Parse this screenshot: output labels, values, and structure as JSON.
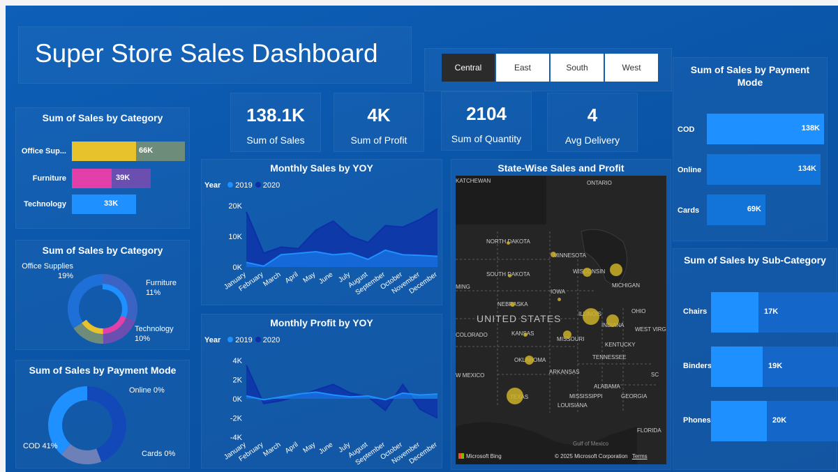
{
  "title": "Super Store Sales Dashboard",
  "region_slicer": {
    "options": [
      "Central",
      "East",
      "South",
      "West"
    ],
    "selected": "Central"
  },
  "kpis": [
    {
      "value": "138.1K",
      "label": "Sum of Sales"
    },
    {
      "value": "4K",
      "label": "Sum of Profit"
    },
    {
      "value": "2104",
      "label": "Sum of Quantity"
    },
    {
      "value": "4",
      "label": "Avg Delivery"
    }
  ],
  "category_bar": {
    "title": "Sum of Sales by Category",
    "items": [
      {
        "label": "Office Sup...",
        "value": "66K",
        "color": "#e8c22c"
      },
      {
        "label": "Furniture",
        "value": "39K",
        "color": "#e040a8"
      },
      {
        "label": "Technology",
        "value": "33K",
        "color": "#1e90ff"
      }
    ]
  },
  "category_donut": {
    "title": "Sum of Sales by Category",
    "labels": [
      {
        "name": "Office Supplies",
        "pct": "19%"
      },
      {
        "name": "Furniture",
        "pct": "11%"
      },
      {
        "name": "Technology",
        "pct": "10%"
      }
    ]
  },
  "payment_donut": {
    "title": "Sum of Sales by Payment Mode",
    "labels": {
      "online": "Online 0%",
      "cod": "COD 41%",
      "cards": "Cards 0%"
    }
  },
  "monthly_sales": {
    "title": "Monthly Sales by YOY",
    "legend_title": "Year",
    "series_names": [
      "2019",
      "2020"
    ],
    "y_ticks": [
      "20K",
      "10K",
      "0K"
    ]
  },
  "monthly_profit": {
    "title": "Monthly Profit by YOY",
    "legend_title": "Year",
    "series_names": [
      "2019",
      "2020"
    ],
    "y_ticks": [
      "4K",
      "2K",
      "0K",
      "-2K",
      "-4K"
    ]
  },
  "map": {
    "title": "State-Wise Sales and Profit",
    "labels": [
      "NORTH DAKOTA",
      "SOUTH DAKOTA",
      "NEBRASKA",
      "KANSAS",
      "OKLAHOMA",
      "TEXAS",
      "MINNESOTA",
      "IOWA",
      "MISSOURI",
      "ARKANSAS",
      "LOUISIANA",
      "MISSISSIPPI",
      "ALABAMA",
      "GEORGIA",
      "FLORIDA",
      "TENNESSEE",
      "KENTUCKY",
      "ILLINOIS",
      "INDIANA",
      "OHIO",
      "WISCONSIN",
      "MICHIGAN",
      "WEST VIRG",
      "SC",
      "UNITED STATES",
      "ONTARIO",
      "KATCHEWAN",
      "COLORADO",
      "W MEXICO",
      "MING",
      "Gulf of Mexico"
    ],
    "credit_left": "Microsoft Bing",
    "credit_right": "© 2025 Microsoft Corporation",
    "terms": "Terms"
  },
  "payment_bar": {
    "title": "Sum of Sales by Payment Mode",
    "items": [
      {
        "label": "COD",
        "value": "138K",
        "pct": 1.0
      },
      {
        "label": "Online",
        "value": "134K",
        "pct": 0.97
      },
      {
        "label": "Cards",
        "value": "69K",
        "pct": 0.5
      }
    ]
  },
  "subcategory_bar": {
    "title": "Sum of Sales by Sub-Category",
    "items": [
      {
        "label": "Chairs",
        "value": "17K"
      },
      {
        "label": "Binders",
        "value": "19K"
      },
      {
        "label": "Phones",
        "value": "20K"
      }
    ]
  },
  "chart_data": [
    {
      "type": "area",
      "title": "Monthly Sales by YOY",
      "categories": [
        "January",
        "February",
        "March",
        "April",
        "May",
        "June",
        "July",
        "August",
        "September",
        "October",
        "November",
        "December"
      ],
      "series": [
        {
          "name": "2019",
          "values": [
            1500,
            300,
            4000,
            4500,
            5000,
            4000,
            4500,
            2500,
            5500,
            4000,
            3800,
            3500
          ]
        },
        {
          "name": "2020",
          "values": [
            18000,
            4500,
            6500,
            6000,
            12000,
            15000,
            10000,
            8000,
            13500,
            13000,
            15500,
            19000
          ]
        }
      ],
      "ylim": [
        0,
        20000
      ],
      "legend": "top-left"
    },
    {
      "type": "area",
      "title": "Monthly Profit by YOY",
      "categories": [
        "January",
        "February",
        "March",
        "April",
        "May",
        "June",
        "July",
        "August",
        "September",
        "October",
        "November",
        "December"
      ],
      "series": [
        {
          "name": "2019",
          "values": [
            300,
            -100,
            200,
            500,
            700,
            400,
            200,
            300,
            -100,
            600,
            400,
            500
          ]
        },
        {
          "name": "2020",
          "values": [
            3500,
            -500,
            -200,
            300,
            900,
            1500,
            600,
            200,
            -1200,
            1500,
            -1100,
            -2000
          ]
        }
      ],
      "ylim": [
        -4000,
        4000
      ],
      "legend": "top-left"
    },
    {
      "type": "pie",
      "title": "Sum of Sales by Category",
      "categories": [
        "Office Supplies",
        "Furniture",
        "Technology"
      ],
      "values": [
        19,
        11,
        10
      ]
    },
    {
      "type": "pie",
      "title": "Sum of Sales by Payment Mode",
      "categories": [
        "COD",
        "Online",
        "Cards"
      ],
      "values": [
        41,
        0,
        0
      ]
    }
  ],
  "colors": {
    "y2019": "#1e90ff",
    "y2020": "#0d2fa8",
    "panel": "#0b5aae"
  }
}
